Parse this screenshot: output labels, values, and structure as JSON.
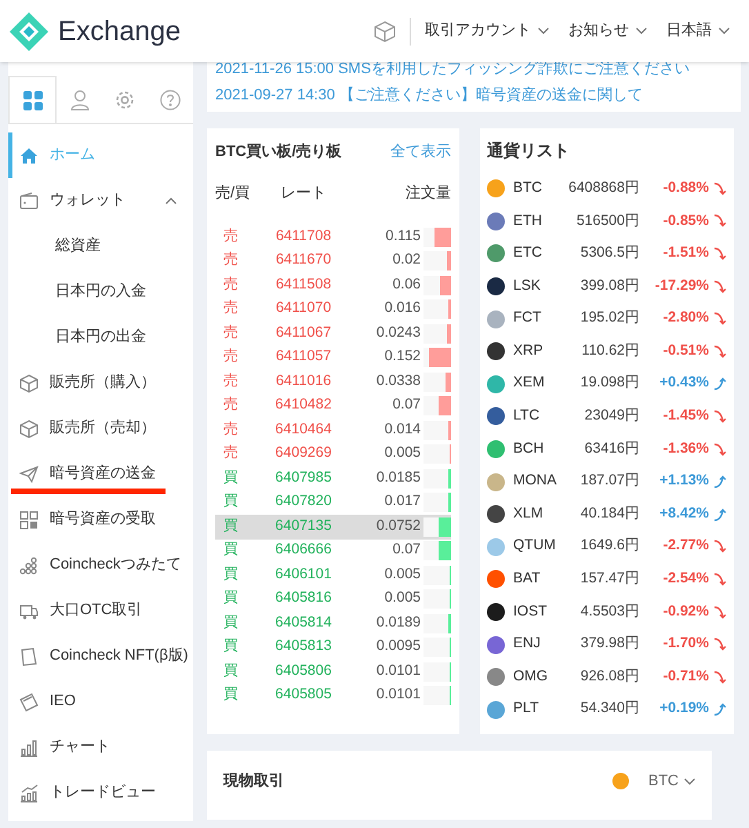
{
  "header": {
    "logo_text": "Exchange",
    "menus": [
      "取引アカウント",
      "お知らせ",
      "日本語"
    ]
  },
  "sidebar": {
    "tabs": [
      {
        "selected": true
      },
      {
        "selected": false
      },
      {
        "selected": false
      },
      {
        "selected": false
      }
    ],
    "items": [
      {
        "label": "ホーム",
        "kind": "main",
        "selected": true
      },
      {
        "label": "ウォレット",
        "kind": "main",
        "selected": false,
        "expanded": true
      },
      {
        "label": "総資産",
        "kind": "sub",
        "selected": false
      },
      {
        "label": "日本円の入金",
        "kind": "sub",
        "selected": false
      },
      {
        "label": "日本円の出金",
        "kind": "sub",
        "selected": false
      },
      {
        "label": "販売所（購入）",
        "kind": "main",
        "selected": false
      },
      {
        "label": "販売所（売却）",
        "kind": "main",
        "selected": false
      },
      {
        "label": "暗号資産の送金",
        "kind": "main",
        "selected": false,
        "underlined": true
      },
      {
        "label": "暗号資産の受取",
        "kind": "main",
        "selected": false
      },
      {
        "label": "Coincheckつみたて",
        "kind": "main",
        "selected": false
      },
      {
        "label": "大口OTC取引",
        "kind": "main",
        "selected": false
      },
      {
        "label": "Coincheck NFT(β版)",
        "kind": "main",
        "selected": false
      },
      {
        "label": "IEO",
        "kind": "main",
        "selected": false
      },
      {
        "label": "チャート",
        "kind": "main",
        "selected": false
      },
      {
        "label": "トレードビュー",
        "kind": "main",
        "selected": false
      }
    ]
  },
  "notices": [
    "2021-11-26 15:00 SMSを利用したフィッシング詐欺にご注意ください",
    "2021-09-27 14:30 【ご注意ください】暗号資産の送金に関して"
  ],
  "order_book": {
    "title": "BTC買い板/売り板",
    "link": "全て表示",
    "columns": [
      "売/買",
      "レート",
      "注文量"
    ],
    "rows": [
      {
        "side": "売",
        "kind": "sell",
        "rate": "6411708",
        "amount": "0.115",
        "level": 0.6,
        "selected": false
      },
      {
        "side": "売",
        "kind": "sell",
        "rate": "6411670",
        "amount": "0.02",
        "level": 0.15,
        "selected": false
      },
      {
        "side": "売",
        "kind": "sell",
        "rate": "6411508",
        "amount": "0.06",
        "level": 0.4,
        "selected": false
      },
      {
        "side": "売",
        "kind": "sell",
        "rate": "6411070",
        "amount": "0.016",
        "level": 0.1,
        "selected": false
      },
      {
        "side": "売",
        "kind": "sell",
        "rate": "6411067",
        "amount": "0.0243",
        "level": 0.15,
        "selected": false
      },
      {
        "side": "売",
        "kind": "sell",
        "rate": "6411057",
        "amount": "0.152",
        "level": 0.8,
        "selected": false
      },
      {
        "side": "売",
        "kind": "sell",
        "rate": "6411016",
        "amount": "0.0338",
        "level": 0.2,
        "selected": false
      },
      {
        "side": "売",
        "kind": "sell",
        "rate": "6410482",
        "amount": "0.07",
        "level": 0.45,
        "selected": false
      },
      {
        "side": "売",
        "kind": "sell",
        "rate": "6410464",
        "amount": "0.014",
        "level": 0.1,
        "selected": false
      },
      {
        "side": "売",
        "kind": "sell",
        "rate": "6409269",
        "amount": "0.005",
        "level": 0.05,
        "selected": false
      },
      {
        "side": "買",
        "kind": "buy",
        "rate": "6407985",
        "amount": "0.0185",
        "level": 0.1,
        "selected": false
      },
      {
        "side": "買",
        "kind": "buy",
        "rate": "6407820",
        "amount": "0.017",
        "level": 0.1,
        "selected": false
      },
      {
        "side": "買",
        "kind": "buy",
        "rate": "6407135",
        "amount": "0.0752",
        "level": 0.45,
        "selected": true
      },
      {
        "side": "買",
        "kind": "buy",
        "rate": "6406666",
        "amount": "0.07",
        "level": 0.45,
        "selected": false
      },
      {
        "side": "買",
        "kind": "buy",
        "rate": "6406101",
        "amount": "0.005",
        "level": 0.05,
        "selected": false
      },
      {
        "side": "買",
        "kind": "buy",
        "rate": "6405816",
        "amount": "0.005",
        "level": 0.05,
        "selected": false
      },
      {
        "side": "買",
        "kind": "buy",
        "rate": "6405814",
        "amount": "0.0189",
        "level": 0.1,
        "selected": false
      },
      {
        "side": "買",
        "kind": "buy",
        "rate": "6405813",
        "amount": "0.0095",
        "level": 0.05,
        "selected": false
      },
      {
        "side": "買",
        "kind": "buy",
        "rate": "6405806",
        "amount": "0.0101",
        "level": 0.05,
        "selected": false
      },
      {
        "side": "買",
        "kind": "buy",
        "rate": "6405805",
        "amount": "0.0101",
        "level": 0.05,
        "selected": false
      }
    ]
  },
  "currency_list": {
    "title": "通貨リスト",
    "rows": [
      {
        "symbol": "BTC",
        "price": "6408868円",
        "change": "-0.88%",
        "kind": "down",
        "color": "#f7a21b"
      },
      {
        "symbol": "ETH",
        "price": "516500円",
        "change": "-0.85%",
        "kind": "down",
        "color": "#6b7bb8"
      },
      {
        "symbol": "ETC",
        "price": "5306.5円",
        "change": "-1.51%",
        "kind": "down",
        "color": "#4f9a6a"
      },
      {
        "symbol": "LSK",
        "price": "399.08円",
        "change": "-17.29%",
        "kind": "down",
        "color": "#1a2a44"
      },
      {
        "symbol": "FCT",
        "price": "195.02円",
        "change": "-2.80%",
        "kind": "down",
        "color": "#a9b3bf"
      },
      {
        "symbol": "XRP",
        "price": "110.62円",
        "change": "-0.51%",
        "kind": "down",
        "color": "#333333"
      },
      {
        "symbol": "XEM",
        "price": "19.098円",
        "change": "+0.43%",
        "kind": "up",
        "color": "#2fb7a8"
      },
      {
        "symbol": "LTC",
        "price": "23049円",
        "change": "-1.45%",
        "kind": "down",
        "color": "#345d9d"
      },
      {
        "symbol": "BCH",
        "price": "63416円",
        "change": "-1.36%",
        "kind": "down",
        "color": "#2fbf71"
      },
      {
        "symbol": "MONA",
        "price": "187.07円",
        "change": "+1.13%",
        "kind": "up",
        "color": "#c9b68a"
      },
      {
        "symbol": "XLM",
        "price": "40.184円",
        "change": "+8.42%",
        "kind": "up",
        "color": "#444444"
      },
      {
        "symbol": "QTUM",
        "price": "1649.6円",
        "change": "-2.77%",
        "kind": "down",
        "color": "#9cc9e8"
      },
      {
        "symbol": "BAT",
        "price": "157.47円",
        "change": "-2.54%",
        "kind": "down",
        "color": "#ff5000"
      },
      {
        "symbol": "IOST",
        "price": "4.5503円",
        "change": "-0.92%",
        "kind": "down",
        "color": "#1c1c1c"
      },
      {
        "symbol": "ENJ",
        "price": "379.98円",
        "change": "-1.70%",
        "kind": "down",
        "color": "#7866d5"
      },
      {
        "symbol": "OMG",
        "price": "926.08円",
        "change": "-0.71%",
        "kind": "down",
        "color": "#888888"
      },
      {
        "symbol": "PLT",
        "price": "54.340円",
        "change": "+0.19%",
        "kind": "up",
        "color": "#5aa6d6"
      }
    ]
  },
  "spot_trade": {
    "title": "現物取引",
    "pair": "BTC"
  }
}
